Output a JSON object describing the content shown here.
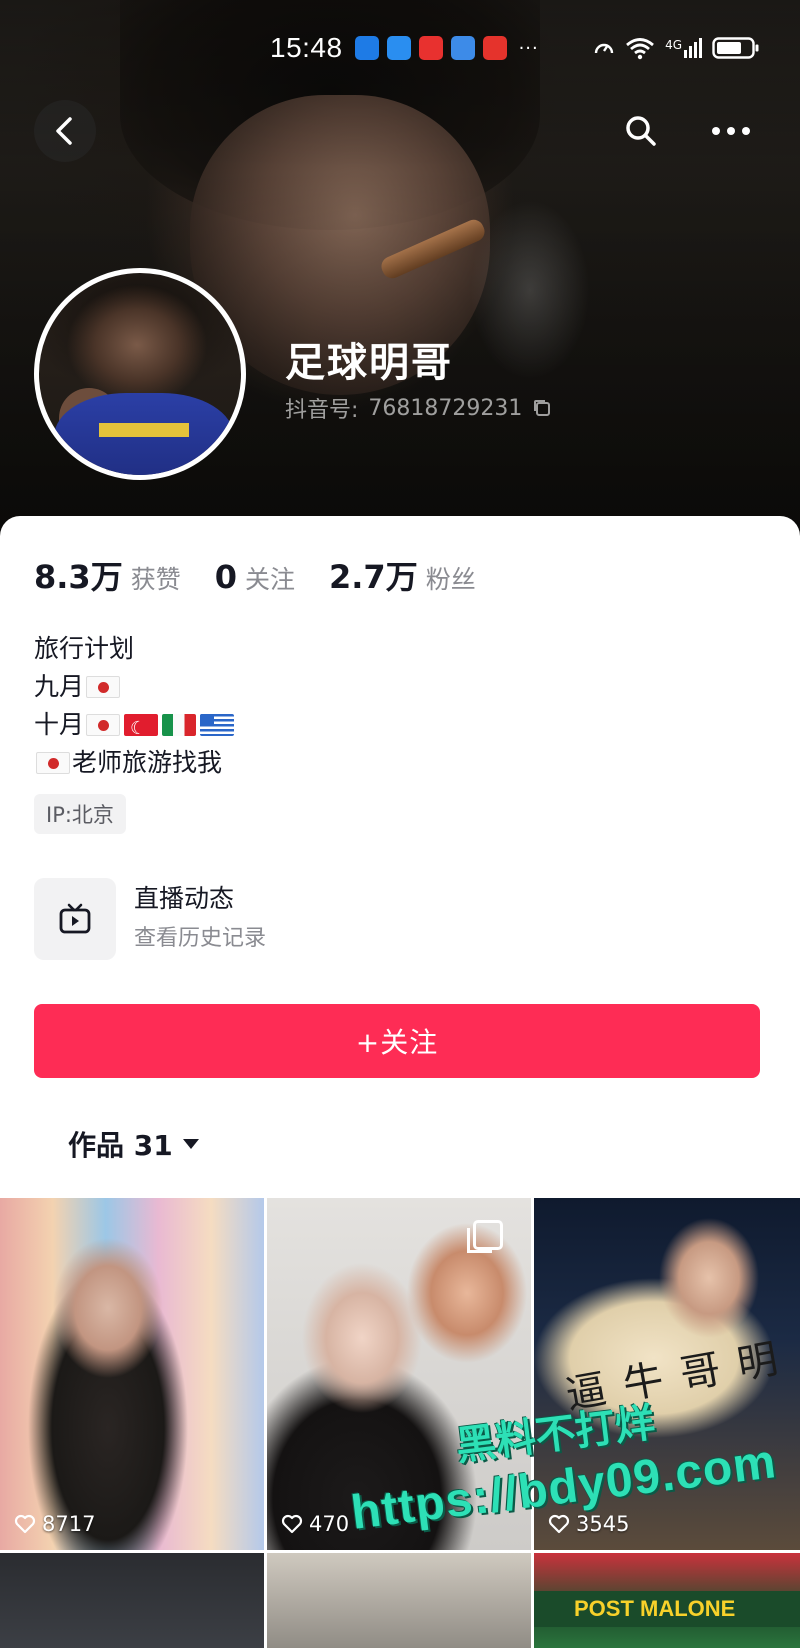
{
  "status_bar": {
    "time": "15:48",
    "more": "···",
    "network": "4G"
  },
  "profile": {
    "username": "足球明哥",
    "douyin_id_label": "抖音号:",
    "douyin_id": "76818729231"
  },
  "stats": [
    {
      "value": "8.3万",
      "label": "获赞"
    },
    {
      "value": "0",
      "label": "关注"
    },
    {
      "value": "2.7万",
      "label": "粉丝"
    }
  ],
  "bio": {
    "line1": "旅行计划",
    "line2": "九月",
    "line3": "十月",
    "line4": "老师旅游找我"
  },
  "ip_tag": "IP:北京",
  "live": {
    "title": "直播动态",
    "subtitle": "查看历史记录"
  },
  "follow_button": "+关注",
  "works_tab": "作品 31",
  "grid": {
    "tiles": [
      {
        "likes": "8717"
      },
      {
        "likes": "470"
      },
      {
        "likes": "3545"
      }
    ],
    "fan_text": "逼牛哥明",
    "tile6_text": "POST MALONE"
  },
  "watermark": {
    "line1": "黑料不打烊",
    "line2": "https://bdy09.com"
  },
  "colors": {
    "accent": "#fe2c55",
    "watermark": "#2de0b6"
  }
}
